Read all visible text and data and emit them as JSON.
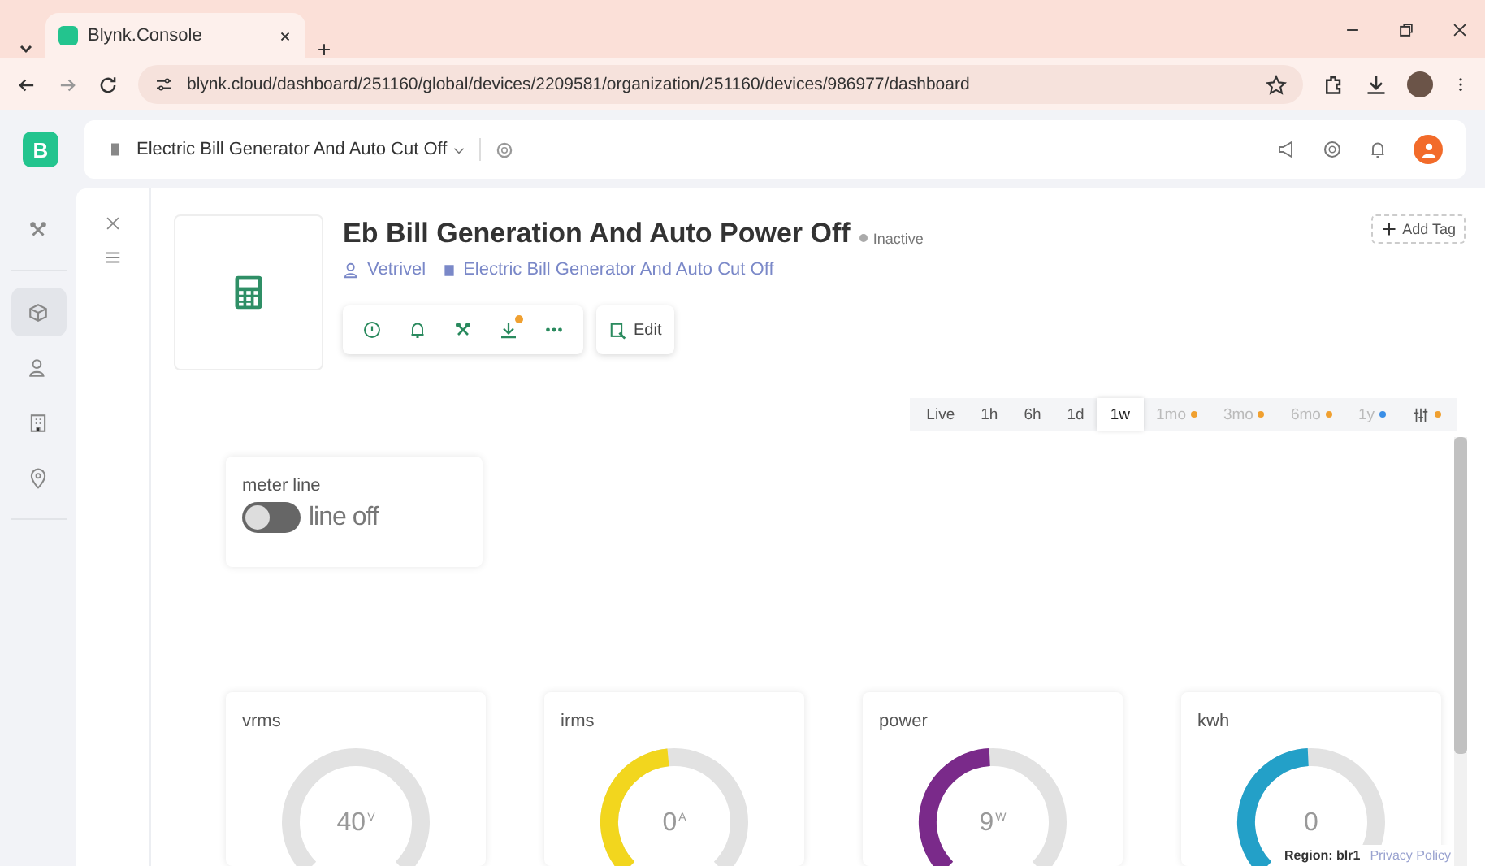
{
  "browser": {
    "tab_title": "Blynk.Console",
    "url": "blynk.cloud/dashboard/251160/global/devices/2209581/organization/251160/devices/986977/dashboard"
  },
  "app_header": {
    "logo": "B",
    "template": "Electric Bill Generator And Auto Cut Off"
  },
  "sidebar": {
    "items": [
      {
        "kind": "tools",
        "selected": false
      },
      {
        "kind": "device",
        "selected": true
      },
      {
        "kind": "users",
        "selected": false
      },
      {
        "kind": "building",
        "selected": false
      },
      {
        "kind": "location",
        "selected": false
      }
    ]
  },
  "device": {
    "title": "Eb Bill Generation And Auto Power Off",
    "status": "Inactive",
    "online": false,
    "owner": "Vetrivel",
    "template": "Electric Bill Generator And Auto Cut Off",
    "download_notice": true,
    "edit": "Edit",
    "add_tag": "Add Tag"
  },
  "time_ranges": [
    {
      "kind": "range",
      "label": "Live",
      "selected": false,
      "disabled": false
    },
    {
      "kind": "range",
      "label": "1h",
      "selected": false,
      "disabled": false
    },
    {
      "kind": "range",
      "label": "6h",
      "selected": false,
      "disabled": false
    },
    {
      "kind": "range",
      "label": "1d",
      "selected": false,
      "disabled": false
    },
    {
      "kind": "range",
      "label": "1w",
      "selected": true,
      "disabled": false
    },
    {
      "kind": "range",
      "label": "1mo",
      "selected": false,
      "disabled": true,
      "color": "#f0a030"
    },
    {
      "kind": "range",
      "label": "3mo",
      "selected": false,
      "disabled": true,
      "color": "#f0a030"
    },
    {
      "kind": "range",
      "label": "6mo",
      "selected": false,
      "disabled": true,
      "color": "#f0a030"
    },
    {
      "kind": "range",
      "label": "1y",
      "selected": false,
      "disabled": true,
      "color": "#3a8ee6"
    },
    {
      "kind": "filter",
      "selected": false,
      "disabled": false,
      "color": "#f0a030"
    }
  ],
  "switch_widget": {
    "title": "meter line",
    "on": false,
    "label": "line off"
  },
  "gauges": [
    {
      "title": "vrms",
      "value": "40",
      "unit": "V"
    },
    {
      "title": "irms",
      "value": "0",
      "unit": "A",
      "level": 0.48,
      "color": "#f2d61e"
    },
    {
      "title": "power",
      "value": "9",
      "unit": "W",
      "level": 0.49,
      "color": "#7a2a8a"
    },
    {
      "title": "kwh",
      "value": "0",
      "level": 0.49,
      "color": "#23a0c8"
    }
  ],
  "footer": {
    "region": "Region: blr1",
    "privacy": "Privacy Policy"
  }
}
